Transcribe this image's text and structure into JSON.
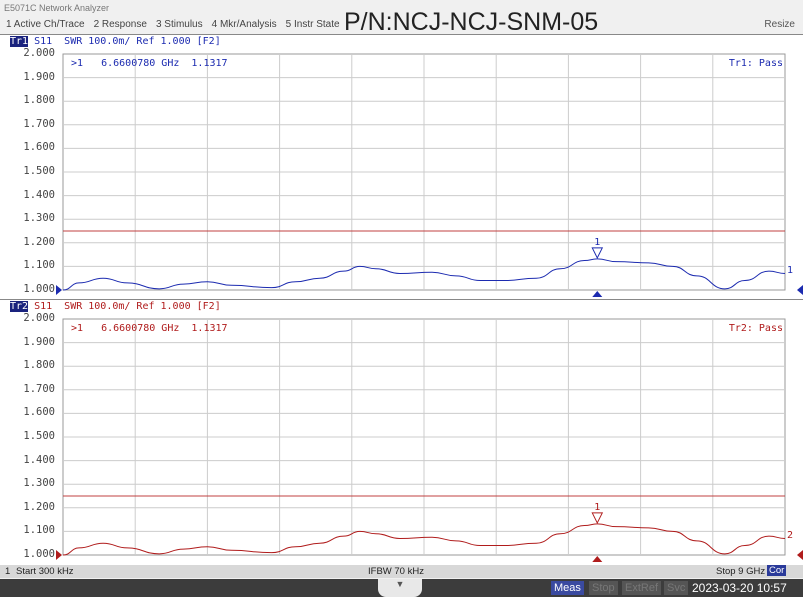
{
  "window": {
    "title": "E5071C Network Analyzer",
    "resize": "Resize",
    "part_number": "P/N:NCJ-NCJ-SNM-05"
  },
  "menu": [
    "1 Active Ch/Trace",
    "2 Response",
    "3 Stimulus",
    "4 Mkr/Analysis",
    "5 Instr State"
  ],
  "y_ticks": [
    "2.000",
    "1.900",
    "1.800",
    "1.700",
    "1.600",
    "1.500",
    "1.400",
    "1.300",
    "1.200",
    "1.100",
    "1.000"
  ],
  "traces": [
    {
      "badge": "Tr1",
      "header": " S11  SWR 100.0m/ Ref 1.000 [F2]",
      "marker_readout": ">1   6.6600780 GHz  1.1317",
      "status": "Tr1: Pass",
      "color": "#1c2bb0",
      "marker_label": "1",
      "end_label": "1"
    },
    {
      "badge": "Tr2",
      "header": " S11  SWR 100.0m/ Ref 1.000 [F2]",
      "marker_readout": ">1   6.6600780 GHz  1.1317",
      "status": "Tr2: Pass",
      "color": "#b01c1c",
      "marker_label": "1",
      "end_label": "2"
    }
  ],
  "chart_data": {
    "type": "line",
    "x_unit": "GHz",
    "xlim": [
      0.0003,
      9
    ],
    "ylim": [
      1.0,
      2.0
    ],
    "limit_line": 1.25,
    "limit_color": "#c04040",
    "grid": true,
    "series_x": [
      0.0003,
      0.2,
      0.5,
      0.8,
      1.2,
      1.5,
      1.8,
      2.1,
      2.6,
      2.9,
      3.2,
      3.5,
      3.7,
      3.9,
      4.2,
      4.6,
      4.9,
      5.2,
      5.5,
      5.9,
      6.2,
      6.5,
      6.66,
      6.9,
      7.3,
      7.6,
      7.9,
      8.25,
      8.5,
      8.8,
      9.0
    ],
    "series_y": [
      1.0,
      1.03,
      1.05,
      1.03,
      1.005,
      1.025,
      1.035,
      1.02,
      1.01,
      1.035,
      1.05,
      1.08,
      1.1,
      1.09,
      1.07,
      1.075,
      1.06,
      1.04,
      1.04,
      1.05,
      1.09,
      1.125,
      1.1317,
      1.12,
      1.115,
      1.1,
      1.06,
      1.005,
      1.04,
      1.08,
      1.07
    ],
    "marker": {
      "x": 6.660078,
      "y": 1.1317
    }
  },
  "footer": {
    "start": "Start 300 kHz",
    "ifbw": "IFBW 70 kHz",
    "stop": "Stop 9 GHz",
    "cor": "Cor",
    "channel": "1"
  },
  "status": {
    "meas": "Meas",
    "stop": "Stop",
    "extref": "ExtRef",
    "svc": "Svc",
    "datetime": "2023-03-20 10:57"
  }
}
